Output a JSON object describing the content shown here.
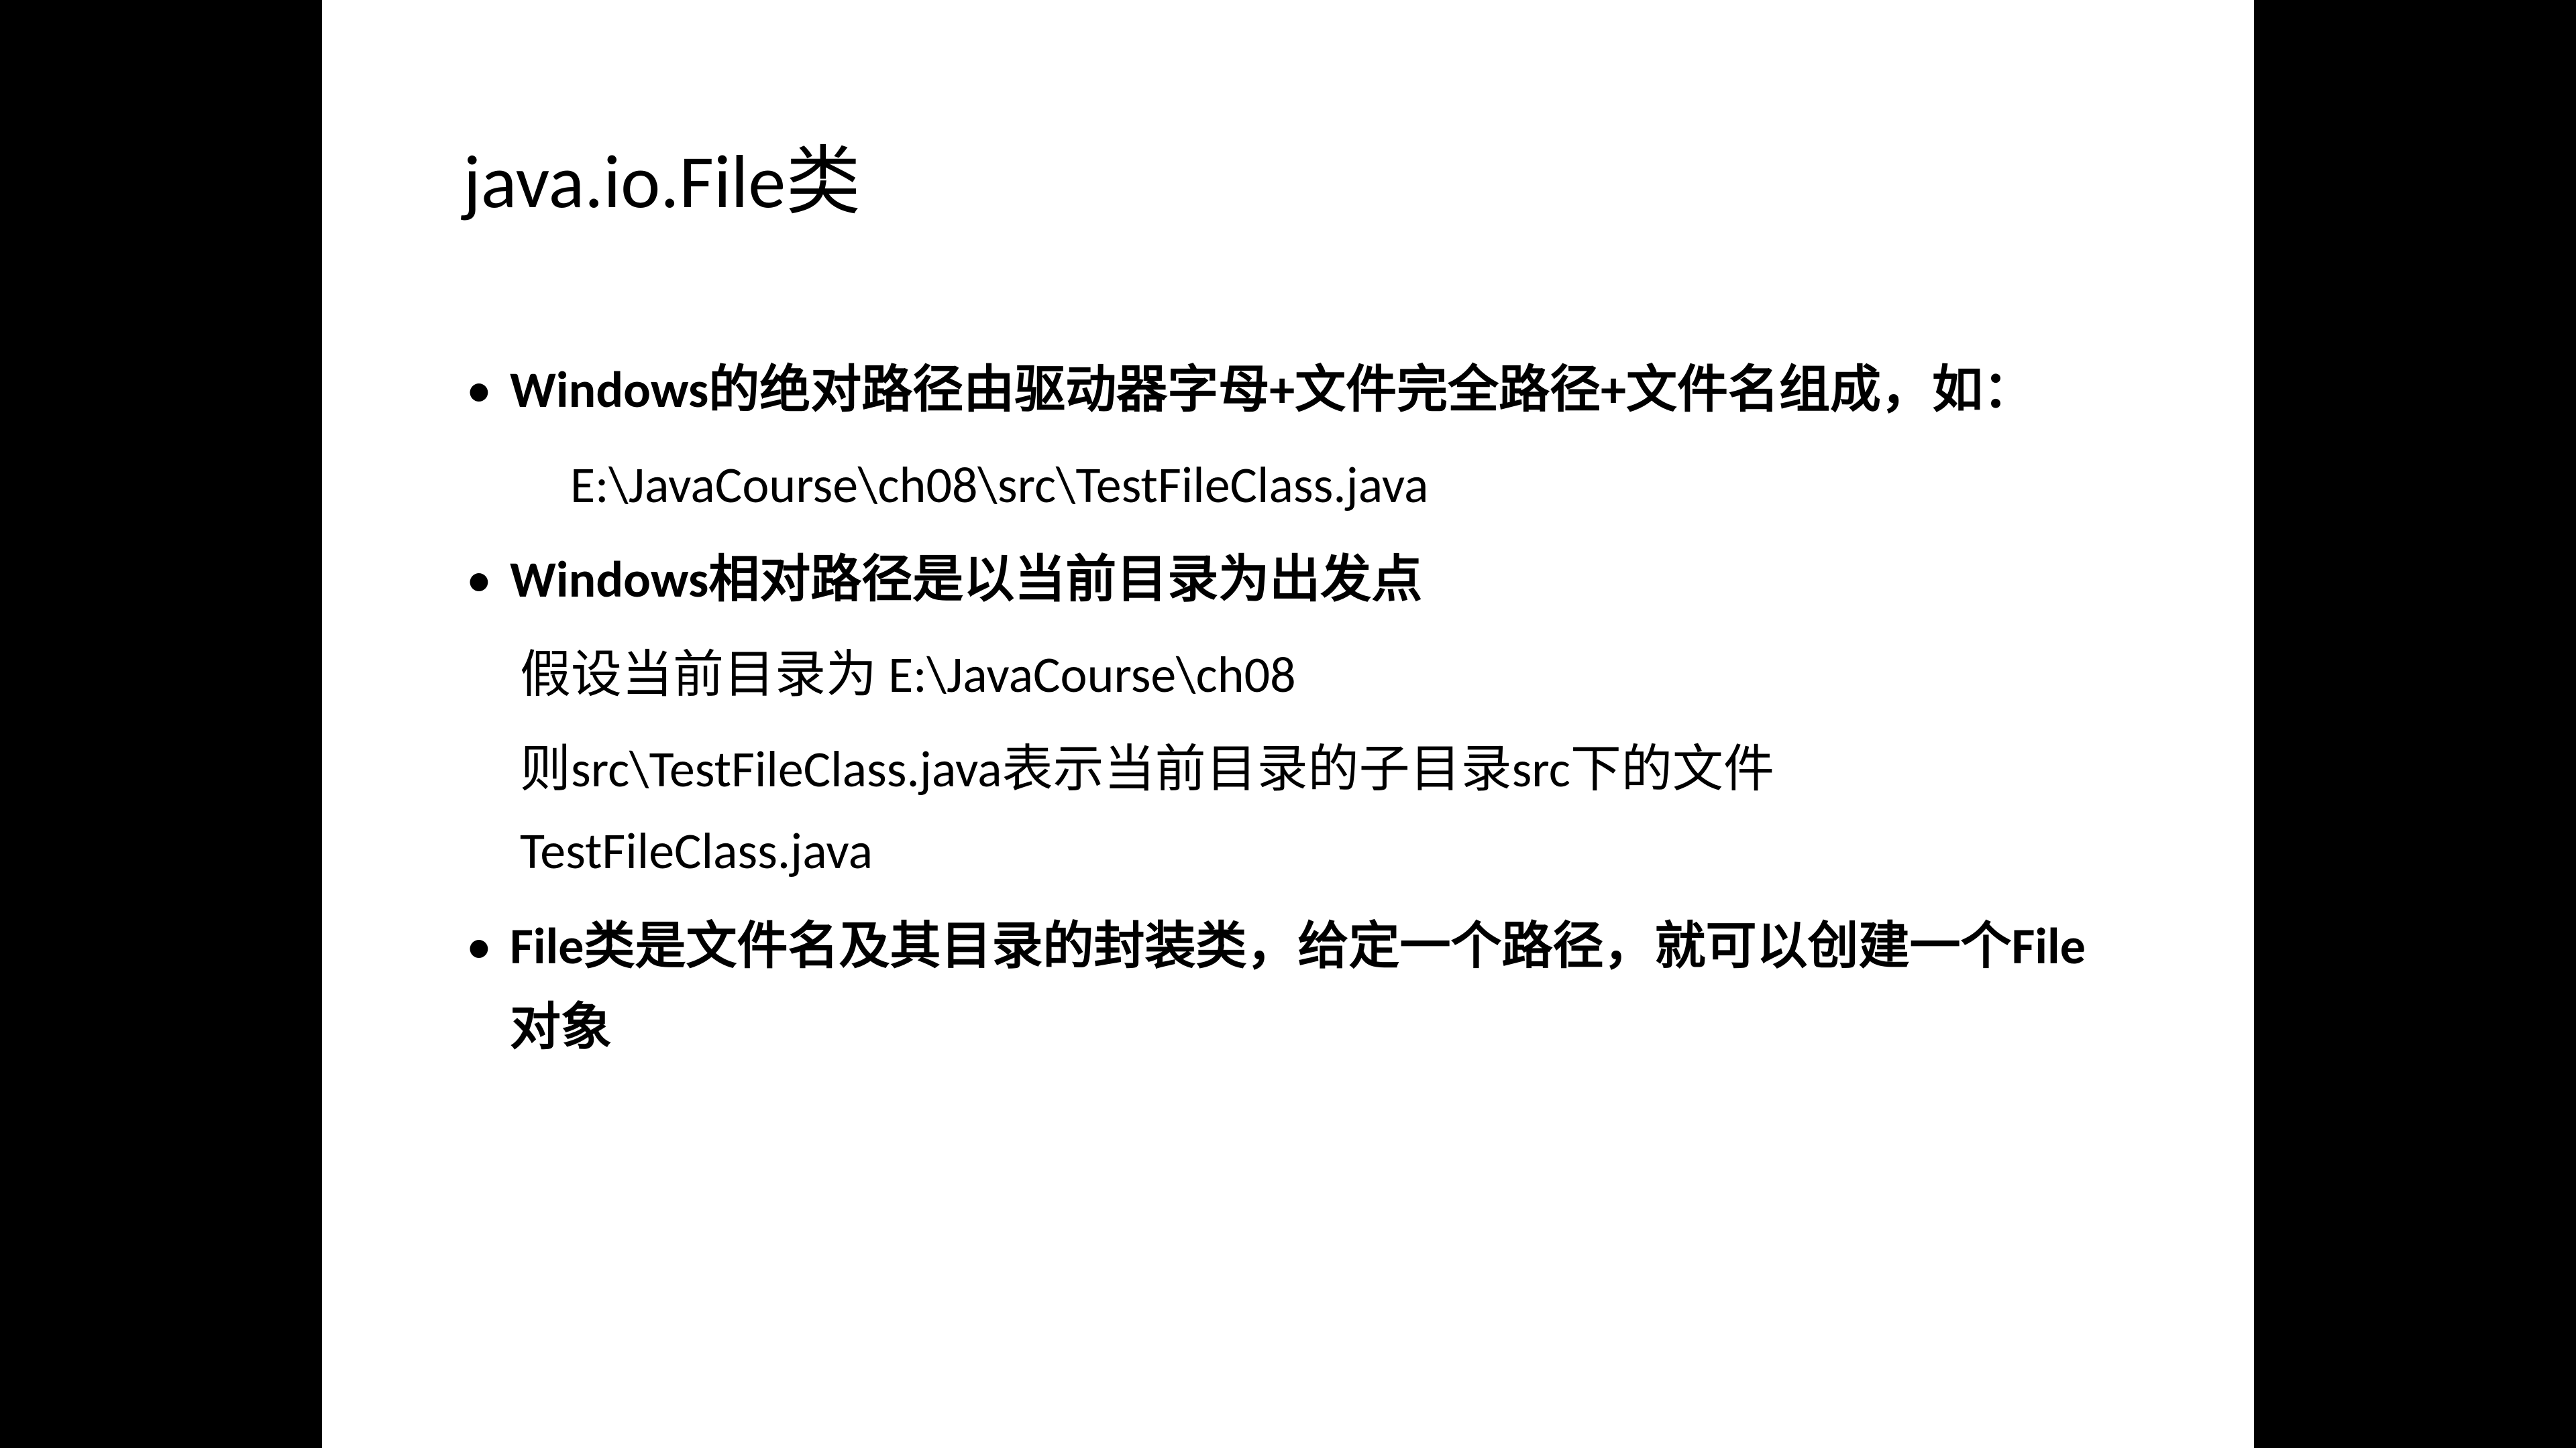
{
  "slide": {
    "title": "java.io.File类",
    "bullet1": "Windows的绝对路径由驱动器字母+文件完全路径+文件名组成，如：",
    "example1": "E:\\JavaCourse\\ch08\\src\\TestFileClass.java",
    "bullet2": "Windows相对路径是以当前目录为出发点",
    "sub2a": "假设当前目录为 E:\\JavaCourse\\ch08",
    "sub2b": "则src\\TestFileClass.java表示当前目录的子目录src下的文件 TestFileClass.java",
    "bullet3": "File类是文件名及其目录的封装类，给定一个路径，就可以创建一个File对象"
  }
}
